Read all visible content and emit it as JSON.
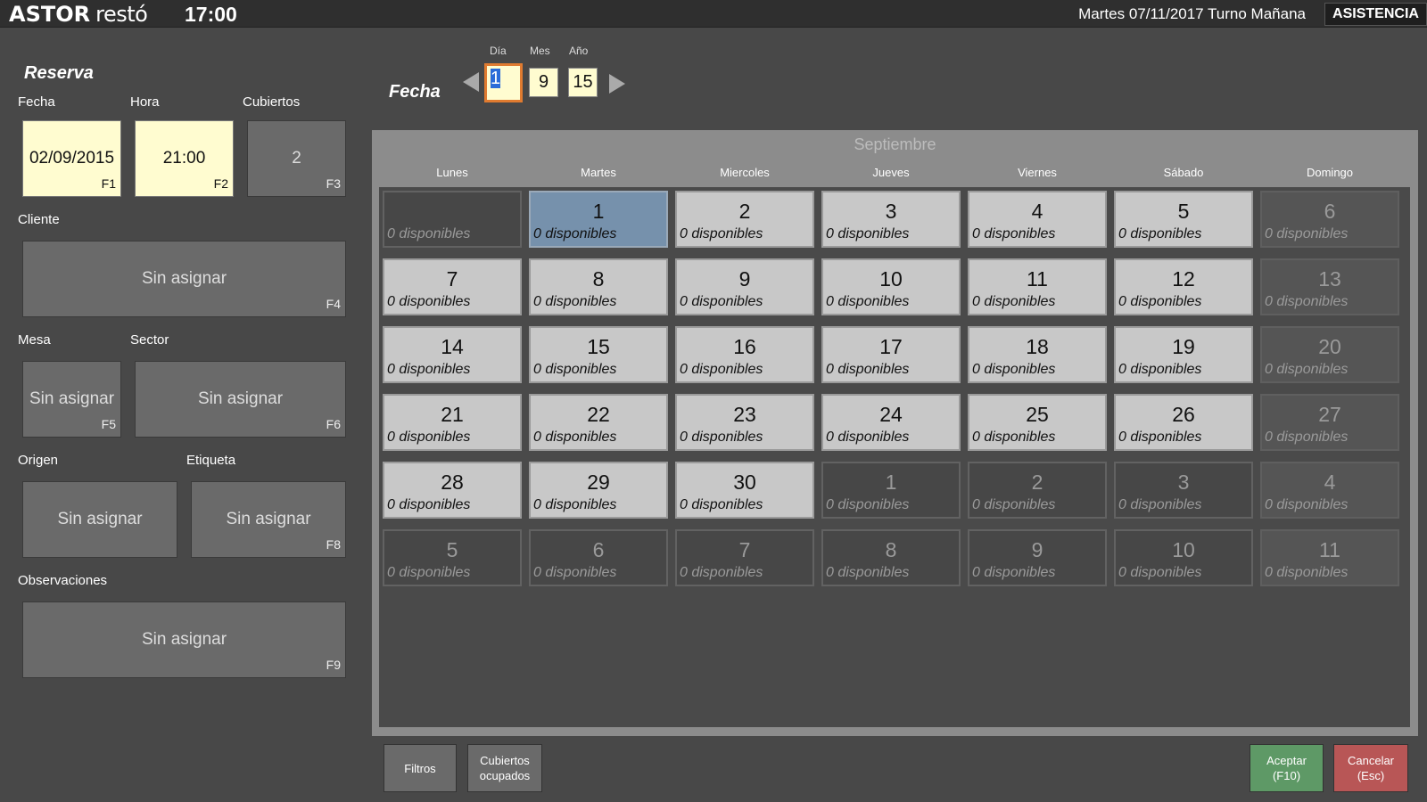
{
  "app": {
    "logo_main": "ASTOR",
    "logo_sub": "restó",
    "clock": "17:00",
    "shift_info": "Martes 07/11/2017 Turno Mañana",
    "assist_label": "ASISTENCIA"
  },
  "reserva": {
    "title": "Reserva",
    "fecha_label": "Fecha",
    "fecha_value": "02/09/2015",
    "fecha_key": "F1",
    "hora_label": "Hora",
    "hora_value": "21:00",
    "hora_key": "F2",
    "cubiertos_label": "Cubiertos",
    "cubiertos_value": "2",
    "cubiertos_key": "F3",
    "cliente_label": "Cliente",
    "cliente_value": "Sin asignar",
    "cliente_key": "F4",
    "mesa_label": "Mesa",
    "mesa_value": "Sin asignar",
    "mesa_key": "F5",
    "sector_label": "Sector",
    "sector_value": "Sin asignar",
    "sector_key": "F6",
    "origen_label": "Origen",
    "origen_value": "Sin asignar",
    "etiqueta_label": "Etiqueta",
    "etiqueta_value": "Sin asignar",
    "etiqueta_key": "F8",
    "observaciones_label": "Observaciones",
    "observaciones_value": "Sin asignar",
    "observaciones_key": "F9"
  },
  "date_picker": {
    "title": "Fecha",
    "dia_label": "Día",
    "dia_value": "1",
    "mes_label": "Mes",
    "mes_value": "9",
    "anio_label": "Año",
    "anio_value": "15"
  },
  "calendar": {
    "month": "Septiembre",
    "weekdays": [
      "Lunes",
      "Martes",
      "Miercoles",
      "Jueves",
      "Viernes",
      "Sábado",
      "Domingo"
    ],
    "avail_text": "0 disponibles",
    "weeks": [
      [
        {
          "n": "",
          "s": "empty"
        },
        {
          "n": "1",
          "s": "selected"
        },
        {
          "n": "2",
          "s": "normal"
        },
        {
          "n": "3",
          "s": "normal"
        },
        {
          "n": "4",
          "s": "normal"
        },
        {
          "n": "5",
          "s": "normal"
        },
        {
          "n": "6",
          "s": "sunday"
        }
      ],
      [
        {
          "n": "7",
          "s": "normal"
        },
        {
          "n": "8",
          "s": "normal"
        },
        {
          "n": "9",
          "s": "normal"
        },
        {
          "n": "10",
          "s": "normal"
        },
        {
          "n": "11",
          "s": "normal"
        },
        {
          "n": "12",
          "s": "normal"
        },
        {
          "n": "13",
          "s": "sunday"
        }
      ],
      [
        {
          "n": "14",
          "s": "normal"
        },
        {
          "n": "15",
          "s": "normal"
        },
        {
          "n": "16",
          "s": "normal"
        },
        {
          "n": "17",
          "s": "normal"
        },
        {
          "n": "18",
          "s": "normal"
        },
        {
          "n": "19",
          "s": "normal"
        },
        {
          "n": "20",
          "s": "sunday"
        }
      ],
      [
        {
          "n": "21",
          "s": "normal"
        },
        {
          "n": "22",
          "s": "normal"
        },
        {
          "n": "23",
          "s": "normal"
        },
        {
          "n": "24",
          "s": "normal"
        },
        {
          "n": "25",
          "s": "normal"
        },
        {
          "n": "26",
          "s": "normal"
        },
        {
          "n": "27",
          "s": "sunday"
        }
      ],
      [
        {
          "n": "28",
          "s": "normal"
        },
        {
          "n": "29",
          "s": "normal"
        },
        {
          "n": "30",
          "s": "normal"
        },
        {
          "n": "1",
          "s": "other"
        },
        {
          "n": "2",
          "s": "other"
        },
        {
          "n": "3",
          "s": "other"
        },
        {
          "n": "4",
          "s": "sunday"
        }
      ],
      [
        {
          "n": "5",
          "s": "other"
        },
        {
          "n": "6",
          "s": "other"
        },
        {
          "n": "7",
          "s": "other"
        },
        {
          "n": "8",
          "s": "other"
        },
        {
          "n": "9",
          "s": "other"
        },
        {
          "n": "10",
          "s": "other"
        },
        {
          "n": "11",
          "s": "sunday"
        }
      ]
    ]
  },
  "buttons": {
    "filtros": "Filtros",
    "cubiertos_line1": "Cubiertos",
    "cubiertos_line2": "ocupados",
    "aceptar_line1": "Aceptar",
    "aceptar_line2": "(F10)",
    "cancelar_line1": "Cancelar",
    "cancelar_line2": "(Esc)"
  },
  "colors": {
    "accept": "#5e9966",
    "cancel": "#b85656",
    "field_yellow": "#fffcd0",
    "selected_day": "#7691ac",
    "focus_border": "#e07b30"
  }
}
